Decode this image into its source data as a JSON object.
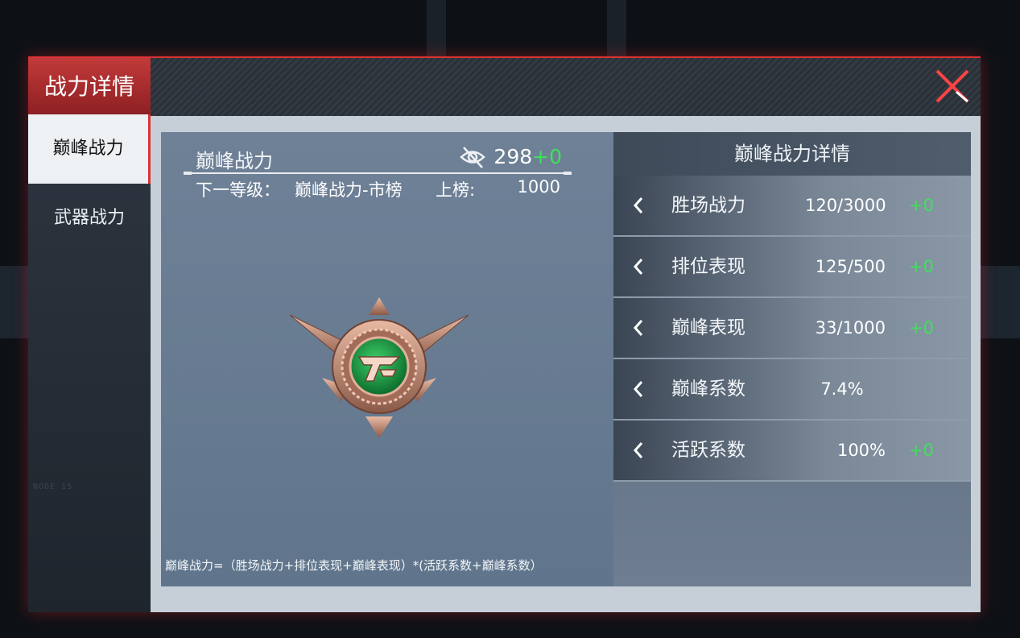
{
  "header": {
    "title": "战力详情"
  },
  "sidebar": {
    "tabs": [
      {
        "label": "巅峰战力",
        "active": true
      },
      {
        "label": "武器战力",
        "active": false
      }
    ]
  },
  "left": {
    "title": "巅峰战力",
    "score": "298",
    "score_delta": "+0",
    "next_label": "下一等级：",
    "next_name": "巅峰战力-市榜",
    "rank_label": "上榜:",
    "rank_value": "1000",
    "formula": "巅峰战力=（胜场战力+排位表现+巅峰表现）*(活跃系数+巅峰系数）"
  },
  "right": {
    "title": "巅峰战力详情",
    "rows": [
      {
        "name": "胜场战力",
        "value": "120/3000",
        "delta": "+0"
      },
      {
        "name": "排位表现",
        "value": "125/500",
        "delta": "+0"
      },
      {
        "name": "巅峰表现",
        "value": "33/1000",
        "delta": "+0"
      },
      {
        "name": "巅峰系数",
        "value": "7.4%",
        "delta": ""
      },
      {
        "name": "活跃系数",
        "value": "100%",
        "delta": "+0"
      }
    ]
  },
  "colors": {
    "accent": "#d33333",
    "positive": "#3fe05a",
    "badge_gem": "#1f9a45",
    "badge_metal": "#c9917a"
  },
  "icons": [
    "close-icon",
    "eye-slash-icon",
    "chevron-left-icon",
    "rank-badge-icon"
  ],
  "deco_text": "NODE 15"
}
